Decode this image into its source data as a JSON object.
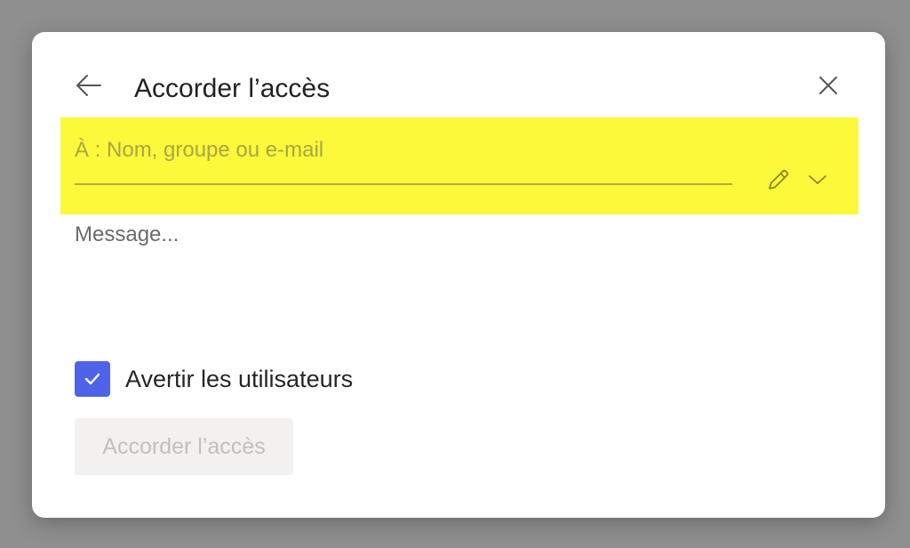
{
  "dialog": {
    "title": "Accorder l’accès",
    "back_icon": "arrow-left-icon",
    "close_icon": "close-icon"
  },
  "recipients": {
    "placeholder": "À : Nom, groupe ou e-mail",
    "value": "",
    "highlight_color": "#fbf93a",
    "edit_icon": "pencil-icon",
    "dropdown_icon": "chevron-down-icon"
  },
  "message": {
    "placeholder": "Message...",
    "value": ""
  },
  "notify": {
    "label": "Avertir les utilisateurs",
    "checked": true,
    "checkbox_color": "#4f63e8"
  },
  "submit": {
    "label": "Accorder l’accès",
    "enabled": false
  }
}
